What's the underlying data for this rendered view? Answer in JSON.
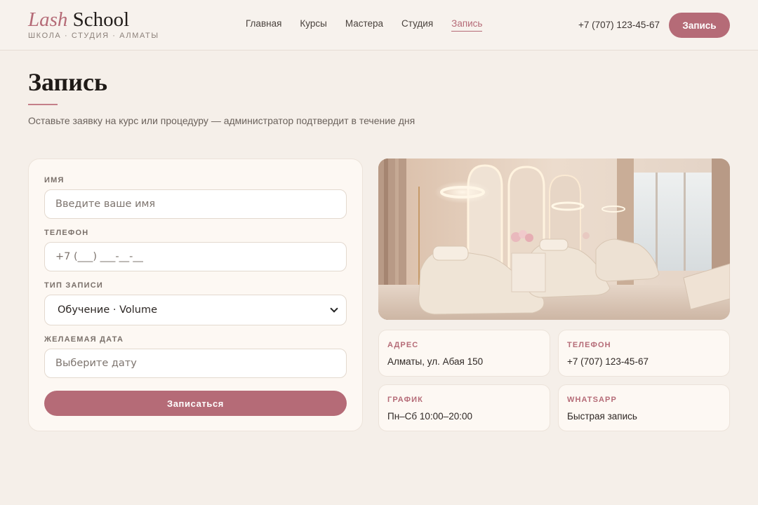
{
  "header": {
    "logo_accent": "Lash",
    "logo_main": "School",
    "logo_sub": "ШКОЛА · СТУДИЯ · АЛМАТЫ",
    "nav": [
      {
        "label": "Главная",
        "active": false
      },
      {
        "label": "Курсы",
        "active": false
      },
      {
        "label": "Мастера",
        "active": false
      },
      {
        "label": "Студия",
        "active": false
      },
      {
        "label": "Запись",
        "active": true
      }
    ],
    "phone": "+7 (707) 123-45-67",
    "cta_label": "Запись"
  },
  "page": {
    "title": "Запись",
    "description": "Оставьте заявку на курс или процедуру — администратор подтвердит в течение дня"
  },
  "form": {
    "name_label": "ИМЯ",
    "name_placeholder": "Введите ваше имя",
    "phone_label": "ТЕЛЕФОН",
    "phone_placeholder": "+7 (___) ___-__-__",
    "type_label": "ТИП ЗАПИСИ",
    "type_value": "Обучение · Volume",
    "date_label": "ЖЕЛАЕМАЯ ДАТА",
    "date_placeholder": "Выберите дату",
    "submit_label": "Записаться"
  },
  "info": {
    "address_label": "АДРЕС",
    "address_value": "Алматы, ул. Абая 150",
    "phone_label": "ТЕЛЕФОН",
    "phone_value": "+7 (707) 123-45-67",
    "schedule_label": "ГРАФИК",
    "schedule_value": "Пн–Сб 10:00–20:00",
    "whatsapp_label": "WHATSAPP",
    "whatsapp_value": "Быстрая запись"
  },
  "colors": {
    "accent": "#b56b77",
    "background": "#f5efe9",
    "card": "#fdf8f3"
  }
}
